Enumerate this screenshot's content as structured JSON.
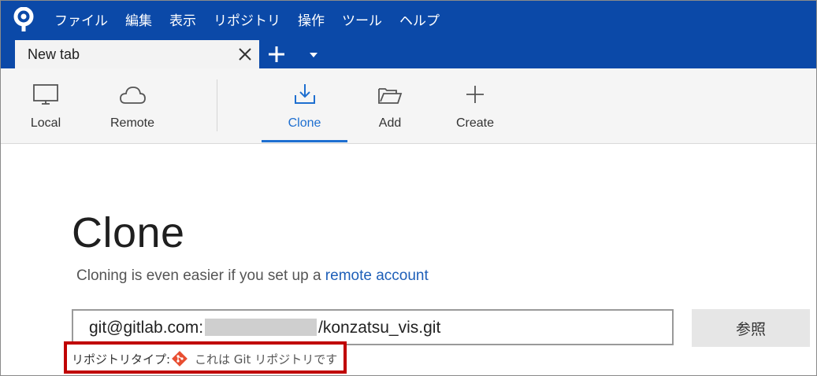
{
  "menu": [
    "ファイル",
    "編集",
    "表示",
    "リポジトリ",
    "操作",
    "ツール",
    "ヘルプ"
  ],
  "tab": {
    "label": "New tab"
  },
  "toolbar": {
    "local": "Local",
    "remote": "Remote",
    "clone": "Clone",
    "add": "Add",
    "create": "Create"
  },
  "page": {
    "title": "Clone",
    "subtitle_text": "Cloning is even easier if you set up a ",
    "subtitle_link": "remote account"
  },
  "source": {
    "prefix": "git@gitlab.com:",
    "suffix": "/konzatsu_vis.git"
  },
  "browse_label": "参照",
  "repo_type": {
    "label": "リポジトリタイプ:",
    "value": "これは Git リポジトリです"
  },
  "colors": {
    "brand": "#0b49a8",
    "accent": "#1e6fd0",
    "highlight": "#c00000",
    "git": "#e84e31"
  }
}
